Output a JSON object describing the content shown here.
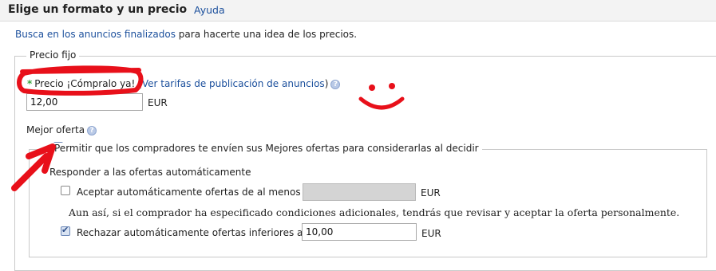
{
  "header": {
    "title": "Elige un formato y un precio",
    "help_link": "Ayuda"
  },
  "intro": {
    "link_text": "Busca en los anuncios finalizados",
    "rest_text": " para hacerte una idea de los precios."
  },
  "fixed_price": {
    "legend": "Precio fijo",
    "required_marker": "*",
    "price_label": "Precio ¡Cómpralo ya!",
    "paren_open": " (",
    "fees_link": "Ver tarifas de publicación de anuncios",
    "paren_close": ")",
    "price_value": "12,00",
    "currency": "EUR"
  },
  "best_offer": {
    "label": "Mejor oferta",
    "allow_label": "Permitir que los compradores te envíen sus Mejores ofertas para considerarlas al decidir",
    "allow_checked": true,
    "auto_respond_label": "Responder a las ofertas automáticamente",
    "auto_accept_label": "Aceptar automáticamente ofertas de al menos",
    "auto_accept_checked": false,
    "auto_accept_value": "",
    "auto_accept_currency": "EUR",
    "note": "Aun así, si el comprador ha especificado condiciones adicionales, tendrás que revisar y aceptar la oferta personalmente.",
    "auto_decline_label": "Rechazar automáticamente ofertas inferiores a",
    "auto_decline_checked": true,
    "auto_decline_value": "10,00",
    "auto_decline_currency": "EUR"
  },
  "colors": {
    "link": "#1b4f9c",
    "required_star": "#3aa640",
    "annotation_red": "#e8101a",
    "disabled_input": "#d4d4d4"
  },
  "icons": [
    "help-question-icon",
    "checkbox-icon"
  ]
}
